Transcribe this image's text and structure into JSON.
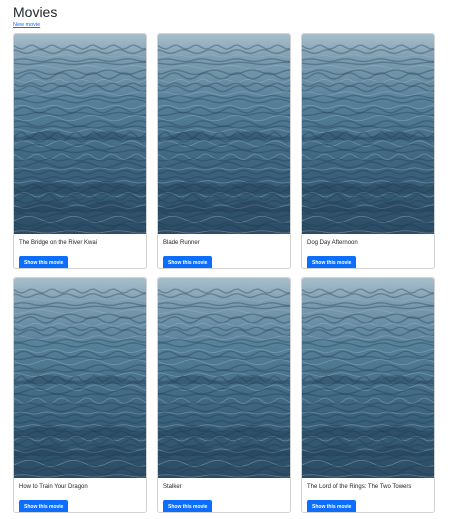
{
  "page": {
    "title": "Movies",
    "new_link": "New movie"
  },
  "movies": [
    {
      "title": "The Bridge on the River Kwai",
      "button_label": "Show this movie",
      "image": "ocean-water-image"
    },
    {
      "title": "Blade Runner",
      "button_label": "Show this movie",
      "image": "ocean-water-image"
    },
    {
      "title": "Dog Day Afternoon",
      "button_label": "Show this movie",
      "image": "ocean-water-image"
    },
    {
      "title": "How to Train Your Dragon",
      "button_label": "Show this movie",
      "image": "ocean-water-image"
    },
    {
      "title": "Stalker",
      "button_label": "Show this movie",
      "image": "ocean-water-image"
    },
    {
      "title": "The Lord of the Rings: The Two Towers",
      "button_label": "Show this movie",
      "image": "ocean-water-image"
    }
  ],
  "colors": {
    "link": "#0d6efd",
    "button": "#0d6efd",
    "water_dark": "#1f3a4f",
    "water_mid": "#4f7a93",
    "water_light": "#9fb8c7"
  }
}
